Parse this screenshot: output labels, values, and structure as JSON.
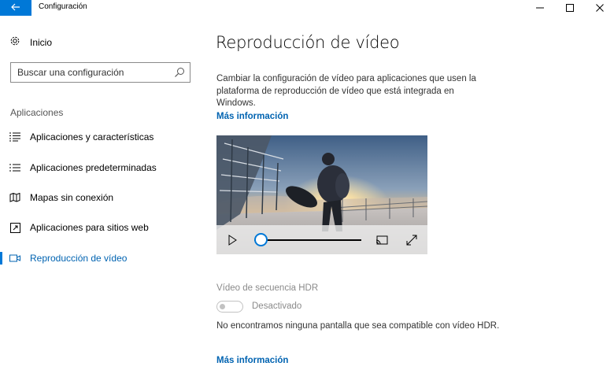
{
  "window": {
    "title": "Configuración",
    "back_icon": "back-arrow-icon",
    "accent": "#0078d7"
  },
  "sidebar": {
    "home": {
      "label": "Inicio",
      "icon": "gear-icon"
    },
    "search": {
      "placeholder": "Buscar una configuración",
      "icon": "search-icon"
    },
    "section": "Aplicaciones",
    "items": [
      {
        "label": "Aplicaciones y características",
        "icon": "apps-list-icon",
        "active": false
      },
      {
        "label": "Aplicaciones predeterminadas",
        "icon": "default-apps-icon",
        "active": false
      },
      {
        "label": "Mapas sin conexión",
        "icon": "offline-maps-icon",
        "active": false
      },
      {
        "label": "Aplicaciones para sitios web",
        "icon": "apps-websites-icon",
        "active": false
      },
      {
        "label": "Reproducción de vídeo",
        "icon": "video-playback-icon",
        "active": true
      }
    ]
  },
  "main": {
    "title": "Reproducción de vídeo",
    "description": "Cambiar la configuración de vídeo para aplicaciones que usen la plataforma de reproducción de vídeo que está integrada en Windows.",
    "more_info_link": "Más información",
    "video": {
      "play_icon": "play-icon",
      "progress": 0.0,
      "cast_icon": "cast-icon",
      "fullscreen_icon": "fullscreen-icon"
    },
    "hdr": {
      "label": "Vídeo de secuencia HDR",
      "toggle_state": "Desactivado",
      "message": "No encontramos ninguna pantalla que sea compatible con vídeo HDR.",
      "more_info_link": "Más información"
    },
    "link_color": "#0063b1"
  }
}
